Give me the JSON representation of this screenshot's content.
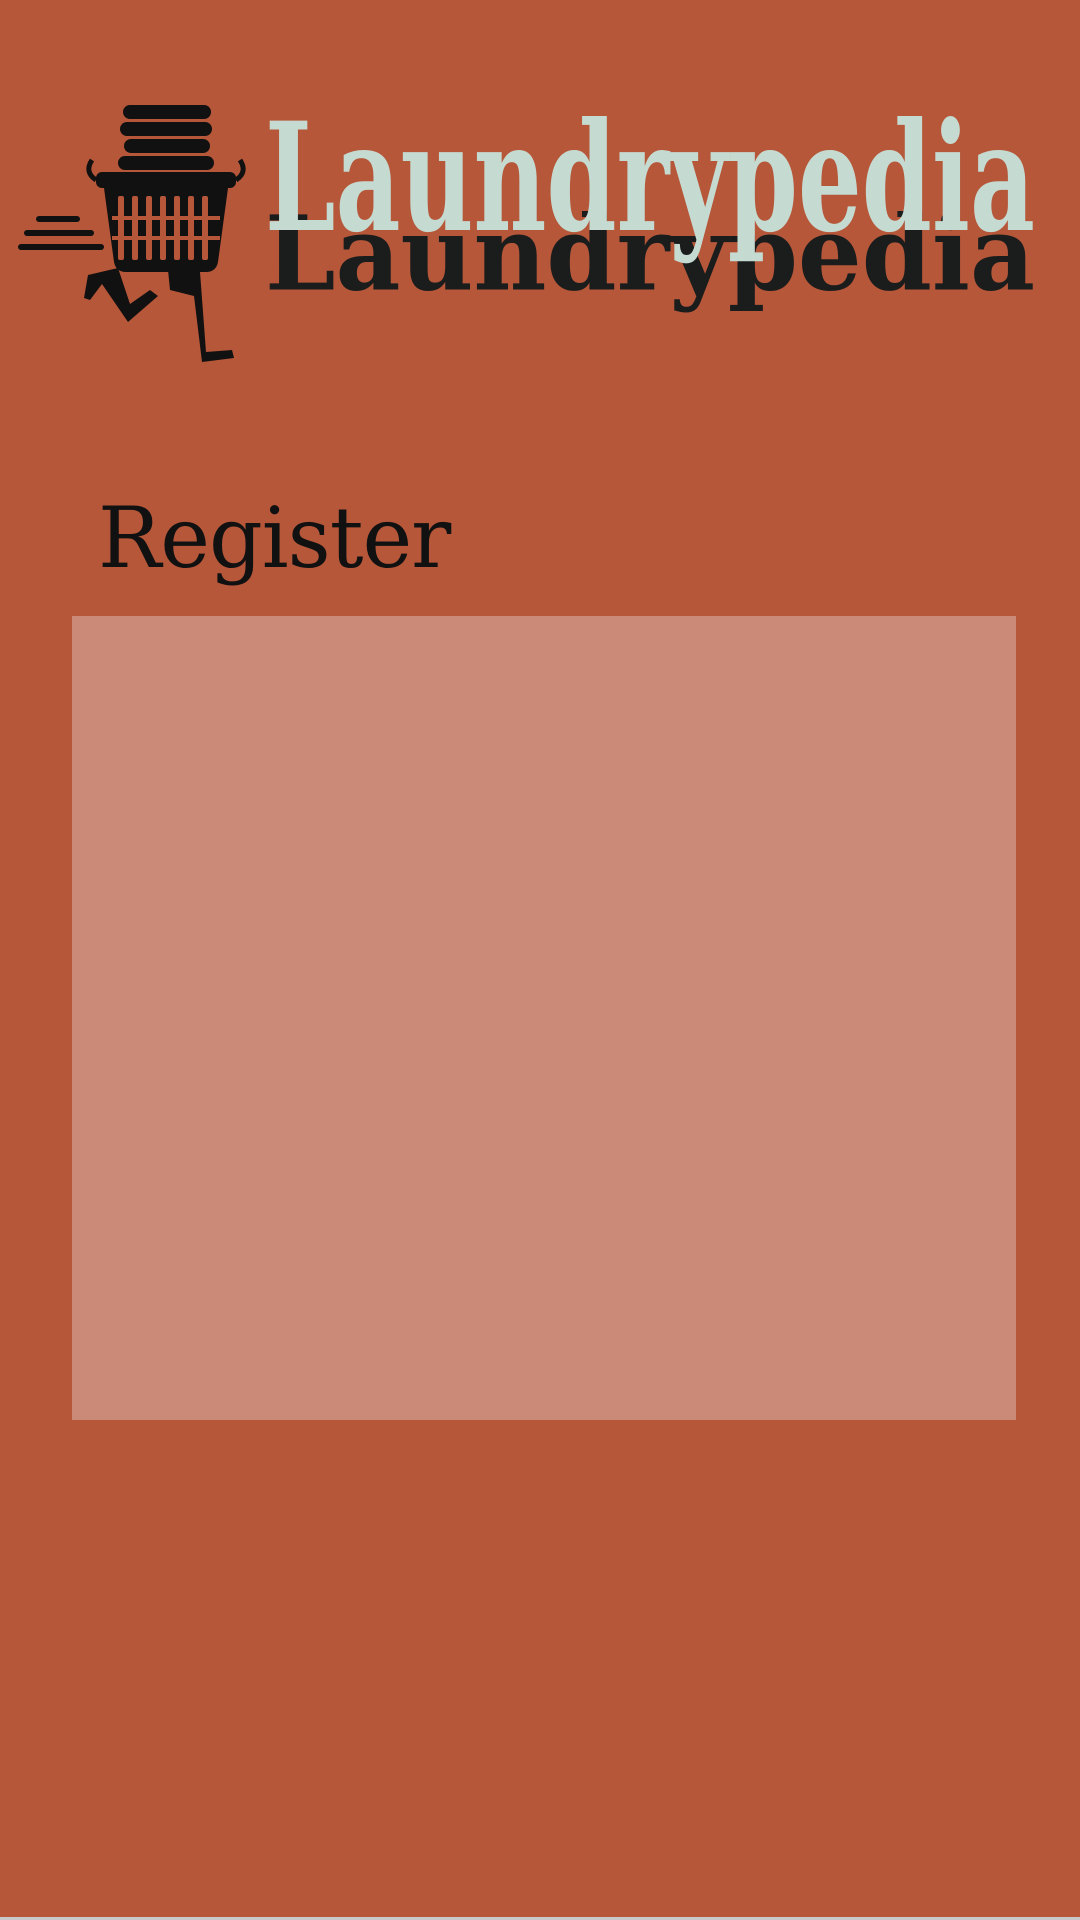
{
  "app": {
    "brand": "Laundrypedia",
    "mascot_icon": "laundry-basket-runner-icon"
  },
  "page": {
    "title": "Register"
  },
  "colors": {
    "background": "#b6573a",
    "panel": "#cb8a77",
    "wordmark_fill": "#c5dad0",
    "wordmark_shadow": "#1b1d1d",
    "title_text": "#111111",
    "mascot": "#111111"
  }
}
